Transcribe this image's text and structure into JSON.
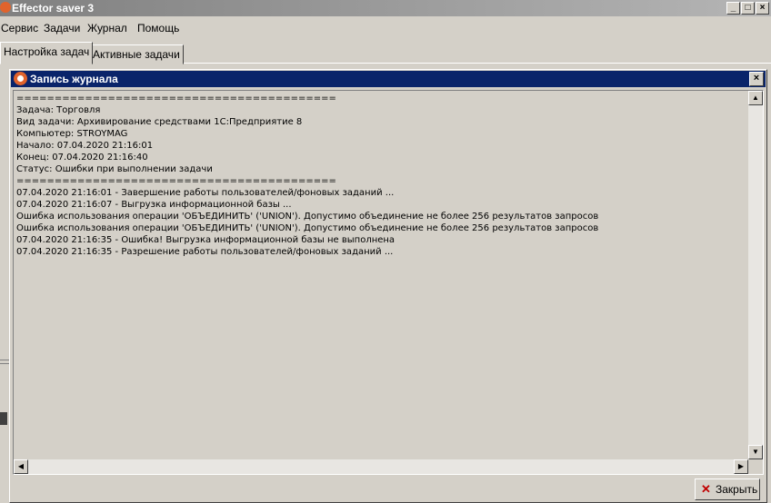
{
  "app": {
    "title": "Effector saver 3"
  },
  "window_controls": {
    "minimize": "_",
    "maximize": "□",
    "close": "×"
  },
  "menu": [
    {
      "label": "Сервис"
    },
    {
      "label": "Задачи"
    },
    {
      "label": "Журнал"
    },
    {
      "label": "Помощь"
    }
  ],
  "tabs": [
    {
      "label": "Настройка задач",
      "active": true
    },
    {
      "label": "Активные задачи",
      "active": false
    }
  ],
  "dialog": {
    "title": "Запись журнала",
    "close_glyph": "×",
    "lines": [
      "==========================================",
      "Задача: Торговля",
      "Вид задачи: Архивирование средствами 1С:Предприятие 8",
      "Компьютер: STROYMAG",
      "Начало: 07.04.2020 21:16:01",
      "Конец: 07.04.2020 21:16:40",
      "Статус: Ошибки при выполнении задачи",
      "==========================================",
      "07.04.2020 21:16:01 - Завершение работы пользователей/фоновых заданий ...",
      "07.04.2020 21:16:07 - Выгрузка информационной базы ...",
      "Ошибка использования операции 'ОБЪЕДИНИТЬ' ('UNION'). Допустимо объединение не более 256 результатов запросов",
      "Ошибка использования операции 'ОБЪЕДИНИТЬ' ('UNION'). Допустимо объединение не более 256 результатов запросов",
      "07.04.2020 21:16:35 - Ошибка! Выгрузка информационной базы не выполнена",
      "07.04.2020 21:16:35 - Разрешение работы пользователей/фоновых заданий ..."
    ],
    "close_button": {
      "icon": "close-icon",
      "label": "Закрыть"
    }
  },
  "colors": {
    "face": "#d4d0c8",
    "active_title": "#0a246a",
    "inactive_title": "#808080",
    "brand": "#e0632c"
  }
}
